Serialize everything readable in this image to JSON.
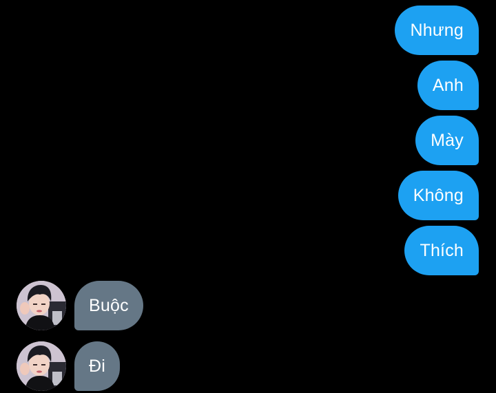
{
  "conversation": {
    "sent_messages": [
      {
        "text": "Nhưng"
      },
      {
        "text": "Anh"
      },
      {
        "text": "Mày"
      },
      {
        "text": "Không"
      },
      {
        "text": "Thích"
      }
    ],
    "received_messages": [
      {
        "text": "Buộc",
        "avatar_icon": "user-avatar-icon"
      },
      {
        "text": "Đi",
        "avatar_icon": "user-avatar-icon"
      }
    ]
  },
  "colors": {
    "background": "#000000",
    "sent_bubble": "#1da1f2",
    "received_bubble": "#657786",
    "text": "#ffffff"
  }
}
